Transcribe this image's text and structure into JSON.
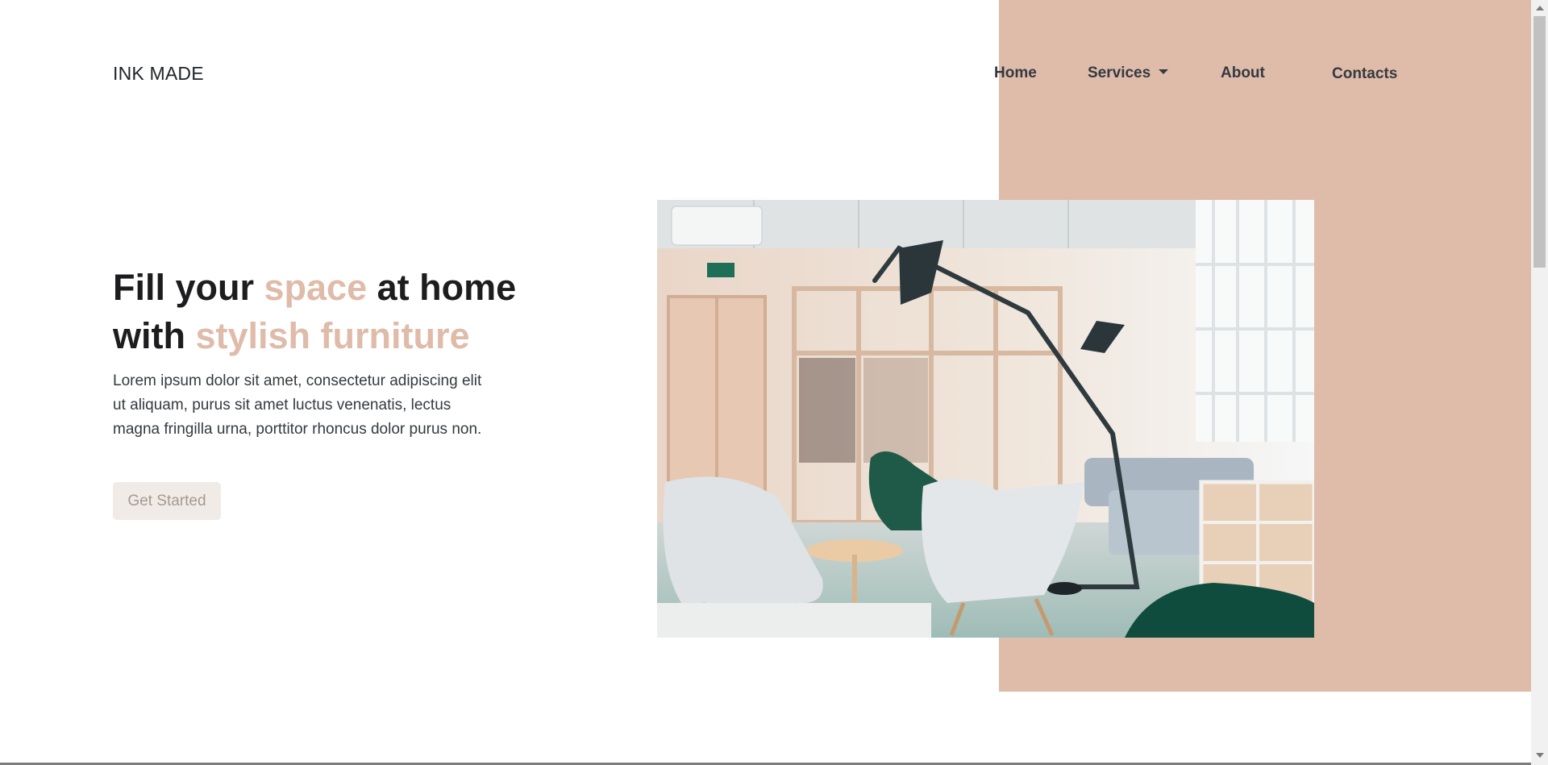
{
  "brand": {
    "name": "INK MADE"
  },
  "nav": {
    "home": "Home",
    "services": "Services",
    "about": "About",
    "contacts": "Contacts"
  },
  "hero": {
    "title_part1": "Fill your ",
    "title_accent1": "space",
    "title_part2": " at home",
    "title_part3": "with ",
    "title_accent2": "stylish furniture",
    "description": "Lorem ipsum dolor sit amet, consectetur adipiscing elit ut aliquam, purus sit amet luctus venenatis, lectus magna fringilla urna, porttitor rhoncus dolor purus non.",
    "cta_label": "Get Started"
  },
  "colors": {
    "accent": "#dfbbaa",
    "heading": "#1d1d1f",
    "text": "#343a40",
    "button_bg": "#f1ebe7",
    "button_text": "#a39a92"
  },
  "icons": {
    "services_caret": "caret-down-icon",
    "scroll_up": "arrow-up-icon",
    "scroll_down": "arrow-down-icon"
  }
}
